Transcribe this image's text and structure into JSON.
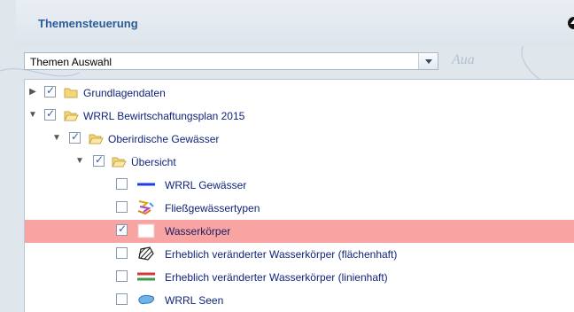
{
  "panel": {
    "title": "Themensteuerung"
  },
  "theme_select": {
    "value": "Themen Auswahl"
  },
  "tree": [
    {
      "label": "Grundlagendaten",
      "checked": true,
      "expander": "collapsed"
    },
    {
      "label": "WRRL Bewirtschaftungsplan 2015",
      "checked": true,
      "expander": "expanded"
    },
    {
      "label": "Oberirdische Gewässer",
      "checked": true,
      "expander": "expanded"
    },
    {
      "label": "Übersicht",
      "checked": true,
      "expander": "expanded"
    },
    {
      "label": "WRRL Gewässer",
      "checked": false,
      "icon": "blue-line-icon"
    },
    {
      "label": "Fließgewässertypen",
      "checked": false,
      "icon": "multicolor-lines-icon"
    },
    {
      "label": "Wasserkörper",
      "checked": true,
      "icon": "white-square-icon",
      "selected": true
    },
    {
      "label": "Erheblich veränderter Wasserkörper (flächenhaft)",
      "checked": false,
      "icon": "hatched-area-icon"
    },
    {
      "label": "Erheblich veränderter Wasserkörper (linienhaft)",
      "checked": false,
      "icon": "red-green-lines-icon"
    },
    {
      "label": "WRRL Seen",
      "checked": false,
      "icon": "lake-shape-icon"
    }
  ],
  "colors": {
    "title": "#2b5c9a",
    "label": "#10247a",
    "selected_row": "#f7a4a2",
    "folder": "#f4d77a"
  },
  "map_label": "Aua"
}
